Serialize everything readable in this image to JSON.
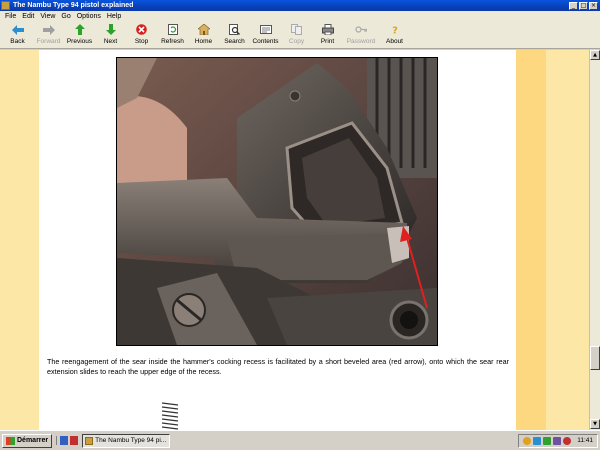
{
  "window": {
    "title": "The Nambu Type 94 pistol explained",
    "controls": [
      "_",
      "□",
      "×"
    ]
  },
  "menu": [
    "File",
    "Edit",
    "View",
    "Go",
    "Options",
    "Help"
  ],
  "toolbar": [
    {
      "label": "Back",
      "icon": "arrow-left-icon",
      "enabled": true
    },
    {
      "label": "Forward",
      "icon": "arrow-right-icon",
      "enabled": false
    },
    {
      "label": "Previous",
      "icon": "arrow-up-icon",
      "enabled": true
    },
    {
      "label": "Next",
      "icon": "arrow-down-icon",
      "enabled": true
    },
    {
      "label": "Stop",
      "icon": "stop-icon",
      "enabled": true
    },
    {
      "label": "Refresh",
      "icon": "refresh-icon",
      "enabled": true
    },
    {
      "label": "Home",
      "icon": "home-icon",
      "enabled": true
    },
    {
      "label": "Search",
      "icon": "search-icon",
      "enabled": true
    },
    {
      "label": "Contents",
      "icon": "contents-icon",
      "enabled": true
    },
    {
      "label": "Copy",
      "icon": "copy-icon",
      "enabled": false
    },
    {
      "label": "Print",
      "icon": "print-icon",
      "enabled": true
    },
    {
      "label": "Password",
      "icon": "password-icon",
      "enabled": false
    },
    {
      "label": "About",
      "icon": "about-icon",
      "enabled": true
    }
  ],
  "page": {
    "photo_alt": "",
    "caption": "The reengagement of the sear inside the hammer's cocking recess is facilitated by a short beveled area (red arrow), onto which the sear rear extension slides to reach the upper edge of the recess."
  },
  "taskbar": {
    "start_label": "Démarrer",
    "task_label": "The Nambu Type 94 pi...",
    "clock": "11:41"
  },
  "colors": {
    "margin": "#fde7a6",
    "margin_inner": "#fdd880",
    "arrow": "#e02020",
    "titlebar": "#0a55df"
  }
}
